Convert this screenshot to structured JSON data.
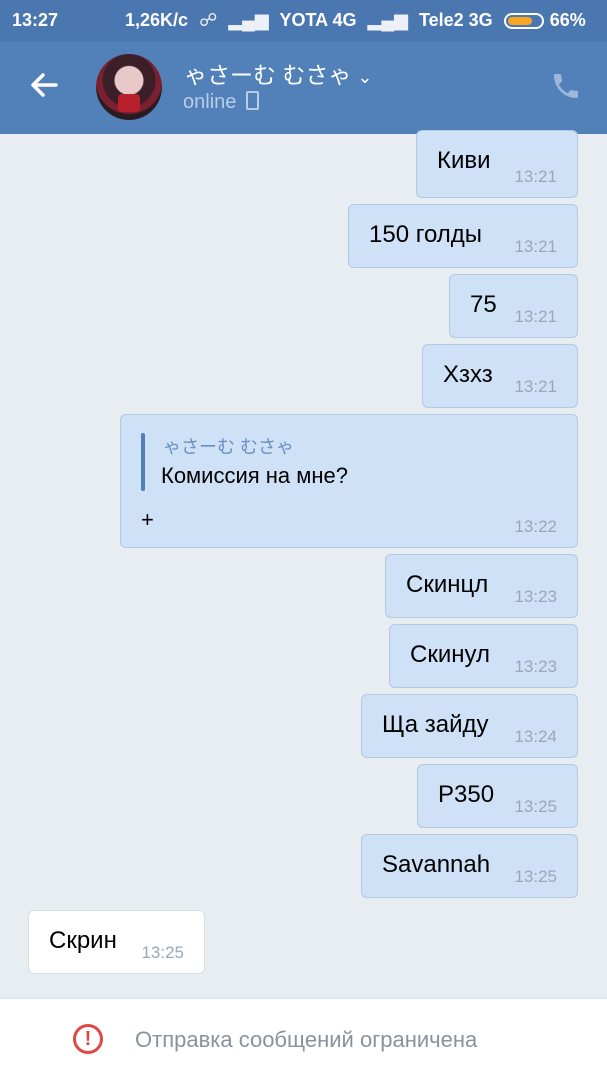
{
  "status_bar": {
    "time": "13:27",
    "speed": "1,26K/c",
    "carrier1": "YOTA 4G",
    "carrier2": "Tele2 3G",
    "battery": "66%"
  },
  "header": {
    "back_icon": "arrow-left-icon",
    "contact_name": "ゃさーむ むさゃ",
    "status": "online",
    "call_icon": "phone-icon"
  },
  "messages": [
    {
      "text": "Киви",
      "time": "13:21"
    },
    {
      "text": "150 голды",
      "time": "13:21"
    },
    {
      "text": "75",
      "time": "13:21"
    },
    {
      "text": "Хзхз",
      "time": "13:21"
    },
    {
      "reply_author": "ゃさーむ むさゃ",
      "reply_text": "Комиссия на мне?",
      "text": "+",
      "time": "13:22"
    },
    {
      "text": "Скинцл",
      "time": "13:23"
    },
    {
      "text": "Скинул",
      "time": "13:23"
    },
    {
      "text": "Ща зайду",
      "time": "13:24"
    },
    {
      "text": "P350",
      "time": "13:25"
    },
    {
      "text": "Savannah",
      "time": "13:25"
    },
    {
      "text": "Скрин",
      "time": "13:25"
    }
  ],
  "footer": {
    "warning_icon": "exclamation-circle-icon",
    "text": "Отправка сообщений ограничена"
  },
  "colors": {
    "header": "#5181b8",
    "outgoing_bubble": "#cfe1f7",
    "incoming_bubble": "#ffffff",
    "warning": "#e04848"
  }
}
